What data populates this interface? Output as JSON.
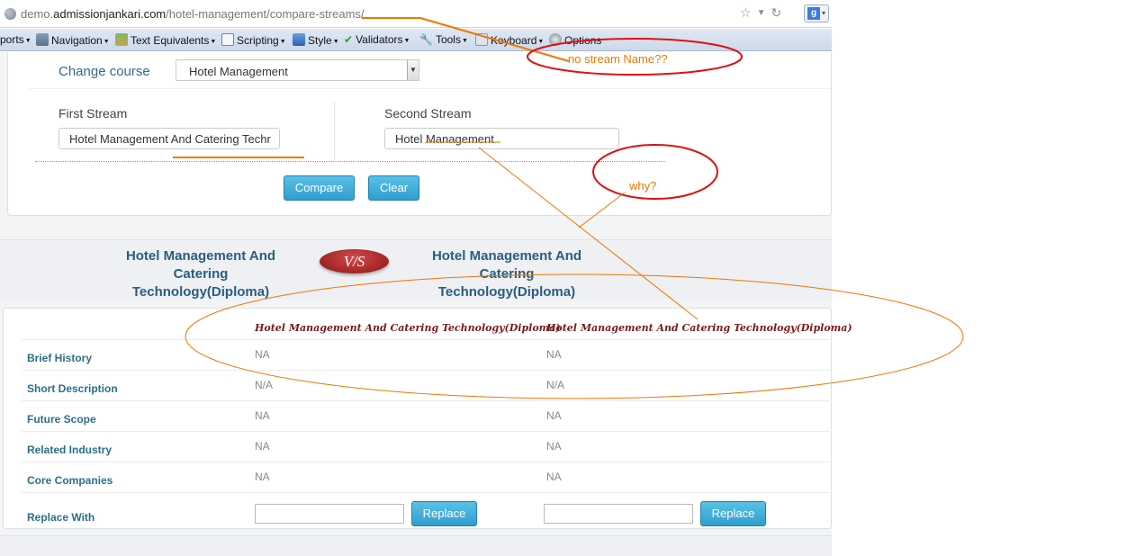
{
  "browser": {
    "url_prefix": "demo.",
    "url_domain": "admissionjankari.com",
    "url_path": "/hotel-management/compare-streams/",
    "star_icon": "star-icon",
    "reload_icon": "reload-icon",
    "search_engine_letter": "g"
  },
  "toolbar": {
    "items": [
      {
        "label": "ports"
      },
      {
        "label": "Navigation"
      },
      {
        "label": "Text Equivalents"
      },
      {
        "label": "Scripting"
      },
      {
        "label": "Style"
      },
      {
        "label": "Validators"
      },
      {
        "label": "Tools"
      },
      {
        "label": "Keyboard"
      },
      {
        "label": "Options"
      }
    ]
  },
  "course": {
    "label": "Change course",
    "selected": "Hotel Management"
  },
  "streams": {
    "first_label": "First Stream",
    "first_value": "Hotel Management And Catering Techr",
    "second_label": "Second Stream",
    "second_value": "Hotel Management"
  },
  "buttons": {
    "compare": "Compare",
    "clear": "Clear",
    "replace": "Replace"
  },
  "vs": {
    "left_title": "Hotel Management And Catering Technology(Diploma)",
    "badge": "V/S",
    "right_title": "Hotel Management And Catering Technology(Diploma)"
  },
  "comparison": {
    "col1": "Hotel Management And Catering Technology(Diploma)",
    "col2": "Hotel Management And Catering Technology(Diploma)",
    "rows": [
      {
        "label": "Brief History",
        "v1": "NA",
        "v2": "NA"
      },
      {
        "label": "Short Description",
        "v1": "N/A",
        "v2": "N/A"
      },
      {
        "label": "Future Scope",
        "v1": "NA",
        "v2": "NA"
      },
      {
        "label": "Related Industry",
        "v1": "NA",
        "v2": "NA"
      },
      {
        "label": "Core Companies",
        "v1": "NA",
        "v2": "NA"
      }
    ],
    "replace_label": "Replace With"
  },
  "annotations": {
    "note1": "no stream Name??",
    "note2": "why?",
    "color": "#ee7700",
    "circle_color": "#dd1111"
  }
}
